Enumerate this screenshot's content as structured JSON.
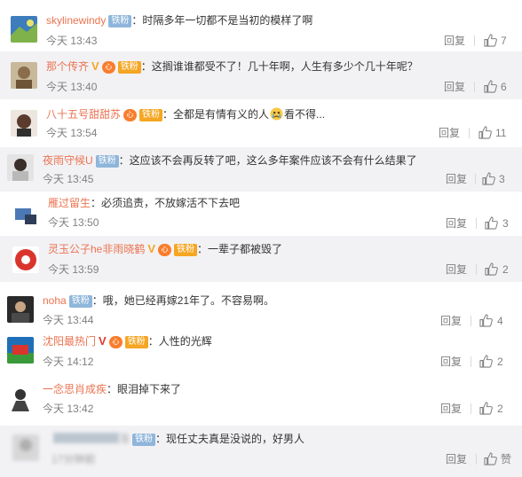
{
  "comments": [
    {
      "username": "skylinewindy",
      "badges": [
        "铁粉"
      ],
      "text": "：时隔多年一切都不是当初的模样了啊",
      "time": "今天 13:43",
      "reply_label": "回复",
      "likes": "7"
    },
    {
      "username": "那个传齐",
      "badges": [
        "V",
        "铁粉"
      ],
      "text": "：这搁谁谁都受不了！几十年啊，人生有多少个几十年呢？",
      "time": "今天 13:40",
      "reply_label": "回复",
      "likes": "6"
    },
    {
      "username": "八十五号甜甜苏",
      "badges": [
        "铁粉"
      ],
      "text": "：全都是有情有义的人",
      "text_after": "看不得...",
      "time": "今天 13:54",
      "reply_label": "回复",
      "likes": "11"
    },
    {
      "username": "夜雨守候U",
      "badges": [
        "铁粉"
      ],
      "text": "：这应该不会再反转了吧，这么多年案件应该不会有什么结果了",
      "time": "今天 13:45",
      "reply_label": "回复",
      "likes": "3"
    },
    {
      "username": "雁过留生",
      "badges": [],
      "text": "：必须追责，不放嫁活不下去吧",
      "time": "今天 13:50",
      "reply_label": "回复",
      "likes": "3"
    },
    {
      "username": "灵玉公子he非雨晓鹤",
      "badges": [
        "V",
        "铁粉"
      ],
      "text": "：一辈子都被毁了",
      "time": "今天 13:59",
      "reply_label": "回复",
      "likes": "2"
    },
    {
      "username": "noha",
      "badges": [
        "铁粉"
      ],
      "text": "：哦，她已经再嫁21年了。不容易啊。",
      "time": "今天 13:44",
      "reply_label": "回复",
      "likes": "4"
    },
    {
      "username": "沈阳最热门",
      "badges": [
        "V",
        "铁粉"
      ],
      "text": "：人性的光辉",
      "time": "今天 14:12",
      "reply_label": "回复",
      "likes": "2"
    },
    {
      "username": "一念思肖成疾",
      "badges": [],
      "text": "：眼泪掉下来了",
      "time": "今天 13:42",
      "reply_label": "回复",
      "likes": "2"
    },
    {
      "username": "落",
      "badges": [
        "铁粉"
      ],
      "text": "：现任丈夫真是没说的，好男人",
      "time": "17分钟前",
      "reply_label": "回复",
      "likes": "赞"
    }
  ],
  "colors": {
    "username": "#eb7350",
    "text": "#333333",
    "meta": "#808080",
    "fan_badge": "#8fb6da",
    "vip": "#f5a623",
    "red_v": "#e03b2f",
    "band": "#f2f2f5"
  },
  "icons": {
    "like": "thumbs-up-icon",
    "emoji": "crying-face-icon"
  },
  "tag_text": "心"
}
